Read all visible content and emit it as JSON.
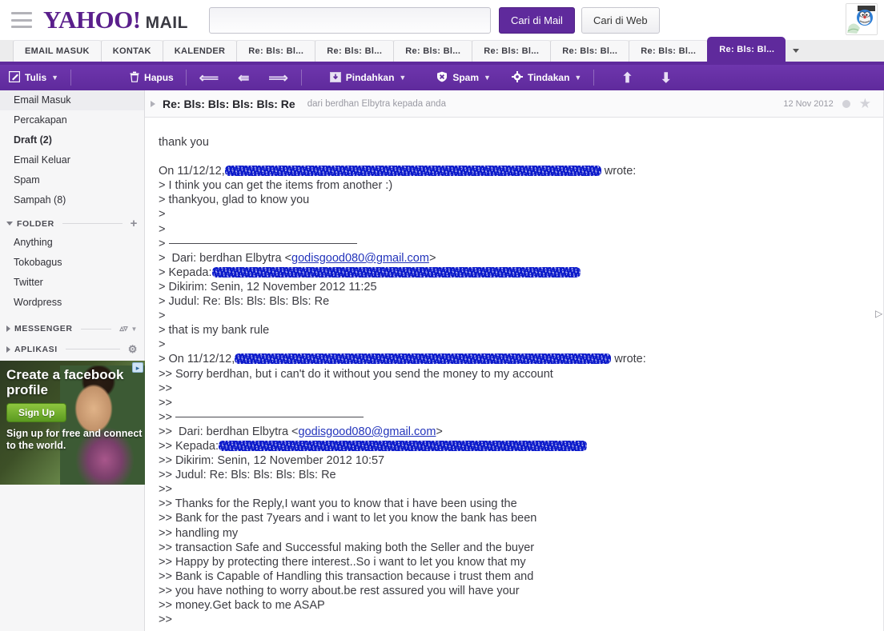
{
  "header": {
    "menu_icon": "hamburger-icon",
    "logo_yahoo": "YAHOO",
    "logo_bang": "!",
    "logo_mail": "MAIL",
    "search_value": "",
    "search_placeholder": "",
    "search_mail_label": "Cari di Mail",
    "search_web_label": "Cari di Web",
    "avatar_alt": "doraemon-avatar"
  },
  "tabs": [
    {
      "label": "EMAIL MASUK",
      "active": false
    },
    {
      "label": "KONTAK",
      "active": false
    },
    {
      "label": "KALENDER",
      "active": false
    },
    {
      "label": "Re: Bls: Bl...",
      "active": false
    },
    {
      "label": "Re: Bls: Bl...",
      "active": false
    },
    {
      "label": "Re: Bls: Bl...",
      "active": false
    },
    {
      "label": "Re: Bls: Bl...",
      "active": false
    },
    {
      "label": "Re: Bls: Bl...",
      "active": false
    },
    {
      "label": "Re: Bls: Bl...",
      "active": false
    },
    {
      "label": "Re: Bls: Bl...",
      "active": true
    }
  ],
  "toolbar": {
    "compose_label": "Tulis",
    "delete_label": "Hapus",
    "reply_icon": "reply-arrow-icon",
    "reply_all_icon": "reply-all-arrow-icon",
    "forward_icon": "forward-arrow-icon",
    "move_label": "Pindahkan",
    "spam_label": "Spam",
    "actions_label": "Tindakan",
    "prev_icon": "arrow-up-icon",
    "next_icon": "arrow-down-icon"
  },
  "sidebar": {
    "folders": [
      {
        "label": "Email Masuk",
        "bold": false,
        "selected": true
      },
      {
        "label": "Percakapan",
        "bold": false,
        "selected": false
      },
      {
        "label": "Draft (2)",
        "bold": true,
        "selected": false
      },
      {
        "label": "Email Keluar",
        "bold": false,
        "selected": false
      },
      {
        "label": "Spam",
        "bold": false,
        "selected": false
      },
      {
        "label": "Sampah (8)",
        "bold": false,
        "selected": false
      }
    ],
    "folder_section_label": "FOLDER",
    "custom_folders": [
      {
        "label": "Anything"
      },
      {
        "label": "Tokobagus"
      },
      {
        "label": "Twitter"
      },
      {
        "label": "Wordpress"
      }
    ],
    "messenger_label": "MESSENGER",
    "aplikasi_label": "APLIKASI"
  },
  "ad": {
    "headline": "Create a\nfacebook\nprofile",
    "button_label": "Sign Up",
    "subtext": "Sign up for free and\nconnect to the world.",
    "adchoices_icon": "adchoices-icon"
  },
  "message": {
    "subject": "Re: Bls: Bls: Bls: Bls: Re",
    "from_line": "dari berdhan Elbytra kepada anda",
    "date": "12 Nov 2012",
    "unread_dot": "unread-dot-icon",
    "star": "star-icon",
    "body_lines": [
      {
        "text": "thank you"
      },
      {
        "text": ""
      },
      {
        "text": "On 11/12/12,",
        "redact_after": 470,
        "suffix": " wrote:"
      },
      {
        "text": "> I think you can get the items from another :)"
      },
      {
        "text": "> thankyou, glad to know you"
      },
      {
        "text": ">"
      },
      {
        "text": ">"
      },
      {
        "text": "> ",
        "rule": true
      },
      {
        "text": ">  Dari: berdhan Elbytra <",
        "link": "godisgood080@gmail.com",
        "suffix": ">"
      },
      {
        "text": "> Kepada:",
        "redact_after": 460
      },
      {
        "text": "> Dikirim: Senin, 12 November 2012 11:25"
      },
      {
        "text": "> Judul: Re: Bls: Bls: Bls: Bls: Re"
      },
      {
        "text": ">"
      },
      {
        "text": "> that is my bank rule"
      },
      {
        "text": ">"
      },
      {
        "text": "> On 11/12/12,",
        "redact_after": 470,
        "suffix": " wrote:"
      },
      {
        "text": ">> Sorry berdhan, but i can't do it without you send the money to my account"
      },
      {
        "text": ">>"
      },
      {
        "text": ">>"
      },
      {
        "text": ">> ",
        "rule": true
      },
      {
        "text": ">>  Dari: berdhan Elbytra <",
        "link": "godisgood080@gmail.com",
        "suffix": ">"
      },
      {
        "text": ">> Kepada:",
        "redact_after": 460
      },
      {
        "text": ">> Dikirim: Senin, 12 November 2012 10:57"
      },
      {
        "text": ">> Judul: Re: Bls: Bls: Bls: Bls: Re"
      },
      {
        "text": ">>"
      },
      {
        "text": ">> Thanks for the Reply,I want you to know that i have been using the"
      },
      {
        "text": ">> Bank for the past 7years and i want to let you know the bank has been"
      },
      {
        "text": ">> handling my"
      },
      {
        "text": ">> transaction Safe and Successful making both the Seller and the buyer"
      },
      {
        "text": ">> Happy by protecting there interest..So i want to let you know that my"
      },
      {
        "text": ">> Bank is Capable of Handling this transaction because i trust them and"
      },
      {
        "text": ">> you have nothing to worry about.be rest assured you will have your"
      },
      {
        "text": ">> money.Get back to me ASAP"
      },
      {
        "text": ">>"
      }
    ]
  },
  "colors": {
    "brand_purple": "#5f2a9c",
    "toolbar_purple": "#6a32a8",
    "redact_blue": "#0a17c8",
    "link_blue": "#2233bb"
  }
}
